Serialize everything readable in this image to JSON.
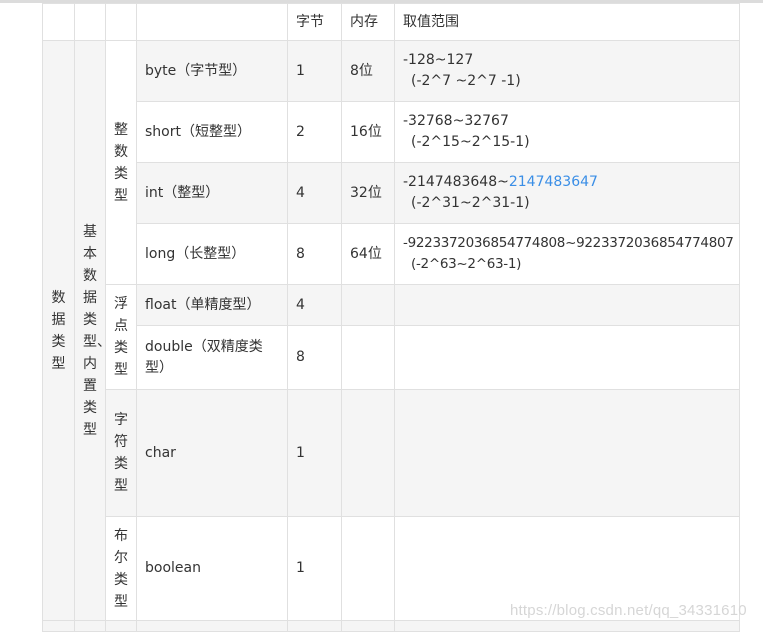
{
  "header": {
    "bytes": "字节",
    "memory": "内存",
    "range": "取值范围"
  },
  "groups": {
    "data_type": "数据类型",
    "basic_type": "基本数据类型、内置类型",
    "integer": "整数类型",
    "float": "浮点类型",
    "char": "字符类型",
    "boolean": "布尔类型"
  },
  "rows": [
    {
      "name": "byte（字节型）",
      "bytes": "1",
      "memory": "8位",
      "range_main": "-128~127",
      "range_link": "",
      "range_sub": "(-2^7 ~2^7 -1)"
    },
    {
      "name": "short（短整型）",
      "bytes": "2",
      "memory": "16位",
      "range_main": "-32768~32767",
      "range_link": "",
      "range_sub": "(-2^15~2^15-1)"
    },
    {
      "name": "int（整型）",
      "bytes": "4",
      "memory": "32位",
      "range_main": "-2147483648~",
      "range_link": "2147483647",
      "range_sub": "(-2^31~2^31-1)"
    },
    {
      "name": "long（长整型）",
      "bytes": "8",
      "memory": "64位",
      "range_main": "-9223372036854774808~9223372036854774807",
      "range_link": "",
      "range_sub": "(-2^63~2^63-1)"
    },
    {
      "name": "float（单精度型）",
      "bytes": "4",
      "memory": "",
      "range_main": "",
      "range_link": "",
      "range_sub": ""
    },
    {
      "name": "double（双精度类型）",
      "bytes": "8",
      "memory": "",
      "range_main": "",
      "range_link": "",
      "range_sub": ""
    },
    {
      "name": "char",
      "bytes": "1",
      "memory": "",
      "range_main": "",
      "range_link": "",
      "range_sub": ""
    },
    {
      "name": "boolean",
      "bytes": "1",
      "memory": "",
      "range_main": "",
      "range_link": "",
      "range_sub": ""
    }
  ],
  "watermark": "https://blog.csdn.net/qq_34331610",
  "colors": {
    "link": "#3a8ee6",
    "row_shade": "#f5f5f5",
    "border": "#e0e0e0"
  }
}
